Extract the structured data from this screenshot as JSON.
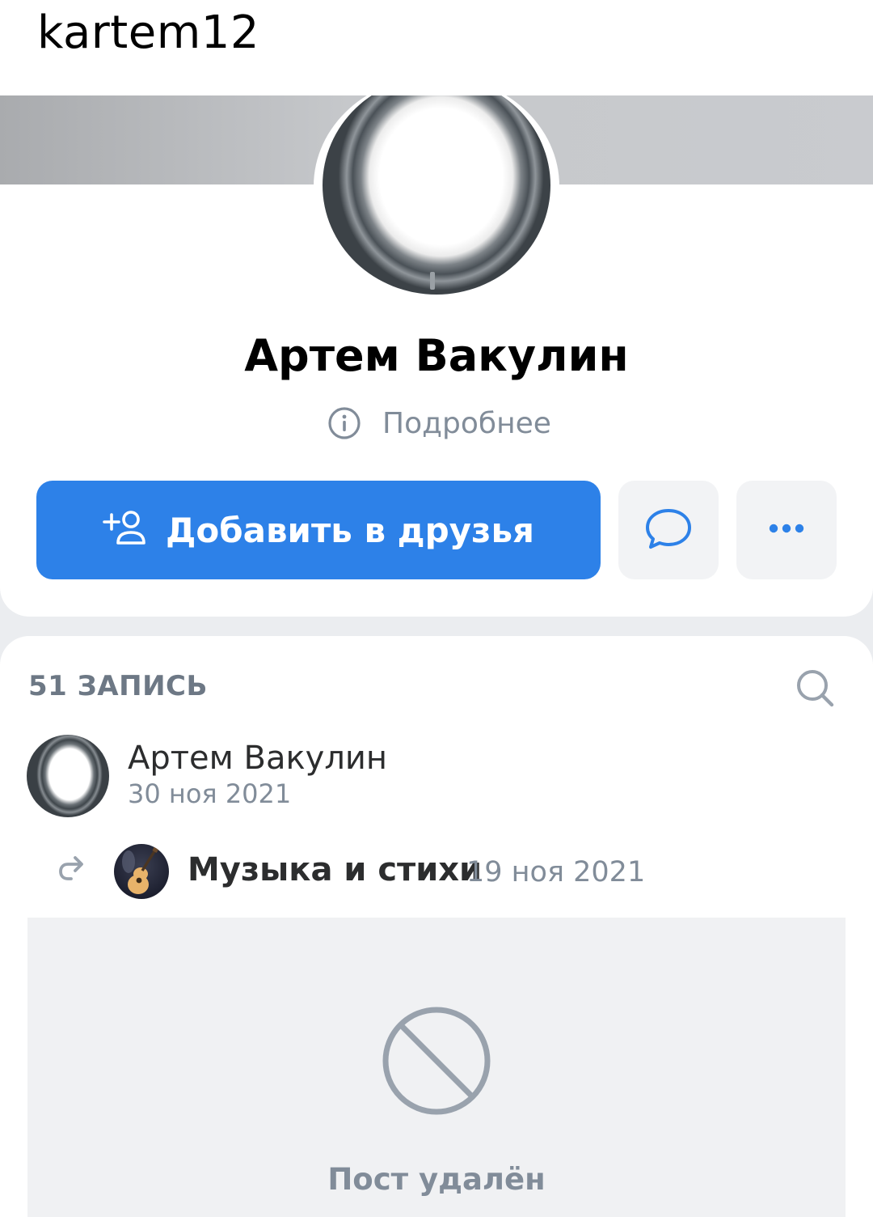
{
  "header": {
    "username": "kartem12"
  },
  "profile": {
    "name": "Артем Вакулин",
    "more_info_label": "Подробнее",
    "add_friend_label": "Добавить в друзья"
  },
  "wall": {
    "count_label": "51 ЗАПИСЬ",
    "post": {
      "author": "Артем Вакулин",
      "date": "30 ноя 2021",
      "repost_source": "Музыка и стихи",
      "repost_date": "19 ноя 2021",
      "deleted_label": "Пост удалён"
    }
  },
  "colors": {
    "accent": "#2d81e8",
    "secondary_text": "#818c99",
    "page_background": "#ebedf0",
    "button_secondary_bg": "#f2f3f5"
  },
  "icons": [
    "info-icon",
    "add-friend-icon",
    "message-icon",
    "more-icon",
    "search-icon",
    "repost-icon",
    "deleted-icon"
  ]
}
